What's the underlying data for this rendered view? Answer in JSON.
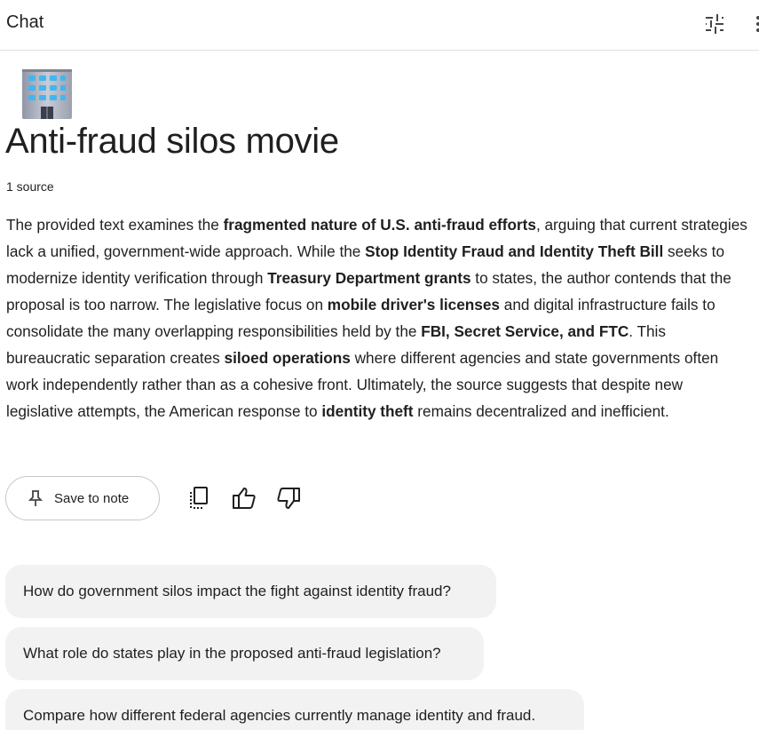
{
  "header": {
    "title": "Chat",
    "tune_icon": "tune-icon",
    "more_icon": "more-vert-icon"
  },
  "notebook": {
    "emoji_icon": "office-building-emoji",
    "title": "Anti-fraud silos movie",
    "source_count": "1 source"
  },
  "summary": [
    {
      "text": "The provided text examines the ",
      "bold": false
    },
    {
      "text": "fragmented nature of U.S. anti-fraud efforts",
      "bold": true
    },
    {
      "text": ", arguing that current strategies lack a unified, government-wide approach. While the ",
      "bold": false
    },
    {
      "text": "Stop Identity Fraud and Identity Theft Bill",
      "bold": true
    },
    {
      "text": " seeks to modernize identity verification through ",
      "bold": false
    },
    {
      "text": "Treasury Department grants",
      "bold": true
    },
    {
      "text": " to states, the author contends that the proposal is too narrow. The legislative focus on ",
      "bold": false
    },
    {
      "text": "mobile driver's licenses",
      "bold": true
    },
    {
      "text": " and digital infrastructure fails to consolidate the many overlapping responsibilities held by the ",
      "bold": false
    },
    {
      "text": "FBI, Secret Service, and FTC",
      "bold": true
    },
    {
      "text": ". This bureaucratic separation creates ",
      "bold": false
    },
    {
      "text": "siloed operations",
      "bold": true
    },
    {
      "text": " where different agencies and state governments often work independently rather than as a cohesive front. Ultimately, the source suggests that despite new legislative attempts, the American response to ",
      "bold": false
    },
    {
      "text": "identity theft",
      "bold": true
    },
    {
      "text": " remains decentralized and inefficient.",
      "bold": false
    }
  ],
  "actions": {
    "save_note_label": "Save to note",
    "pin_icon": "pin-icon",
    "copy_icon": "copy-icon",
    "thumbs_up_icon": "thumbs-up-icon",
    "thumbs_down_icon": "thumbs-down-icon"
  },
  "suggestions": [
    "How do government silos impact the fight against identity fraud?",
    "What role do states play in the proposed anti-fraud legislation?",
    "Compare how different federal agencies currently manage identity and fraud."
  ]
}
